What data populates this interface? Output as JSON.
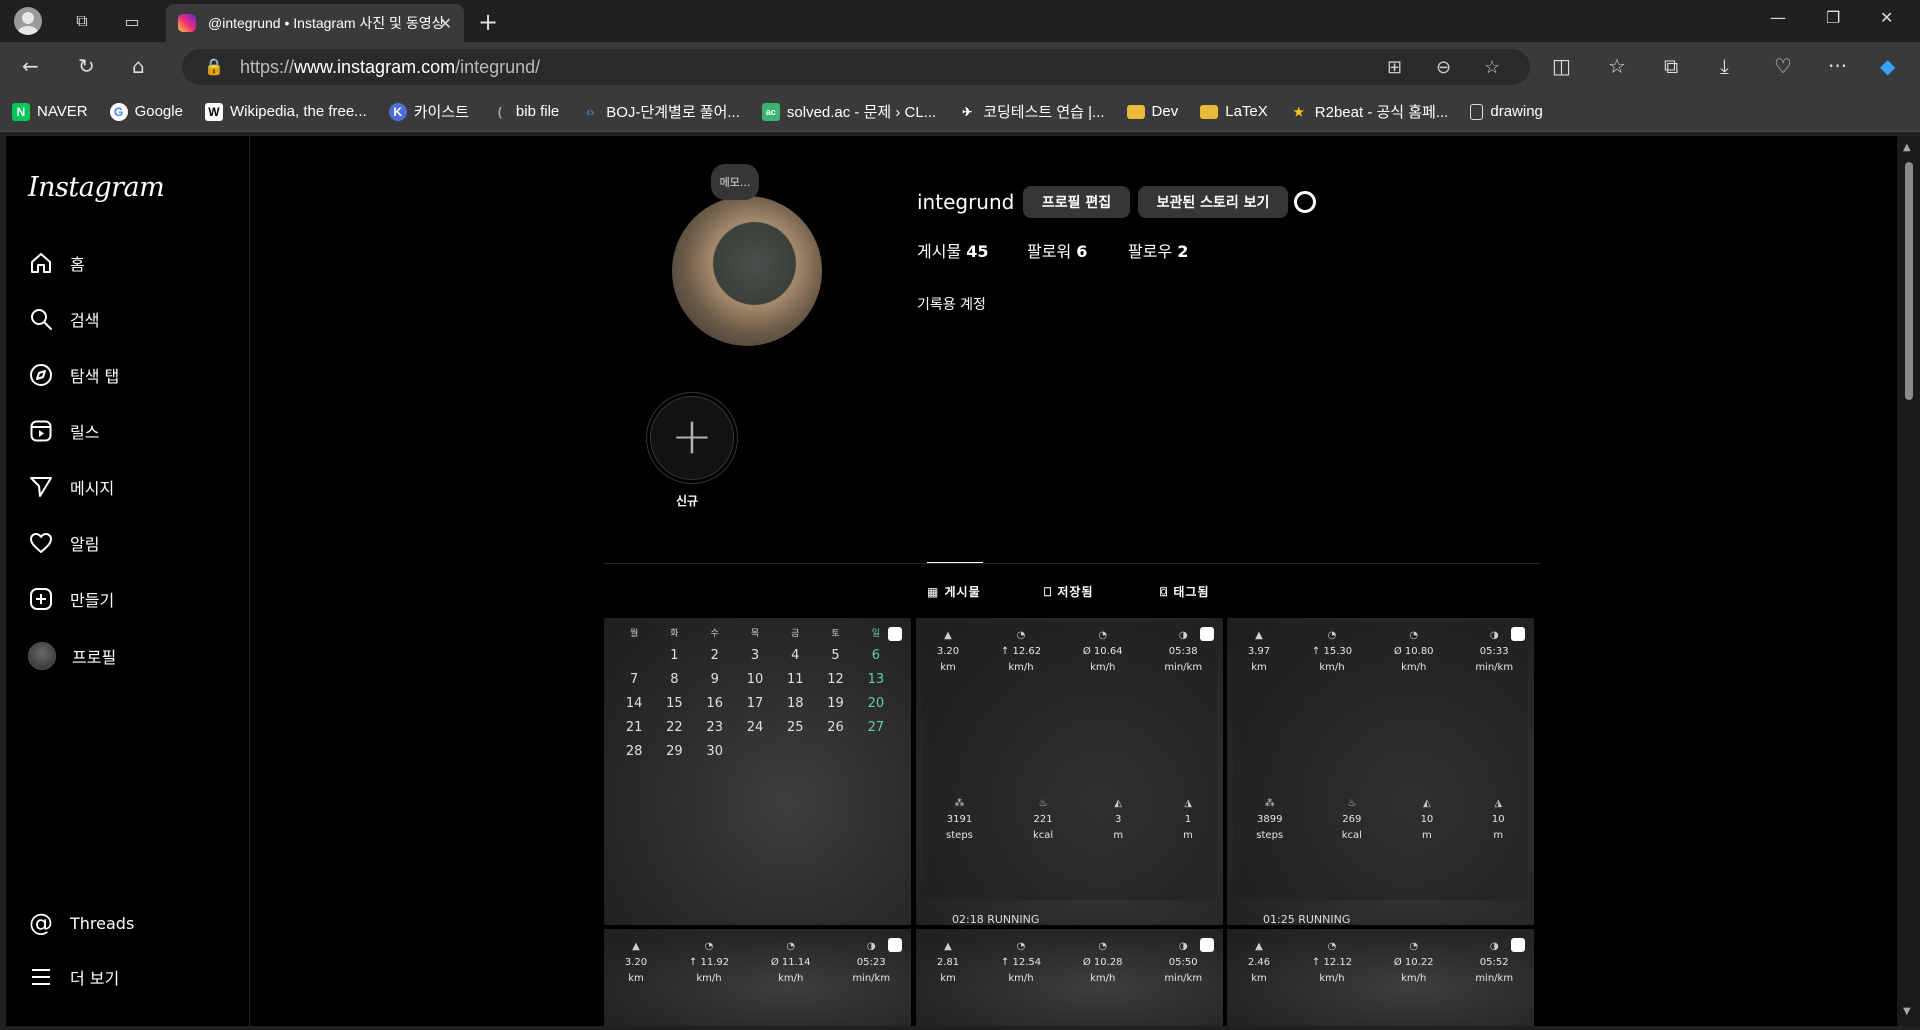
{
  "browser": {
    "tab_title": "@integrund • Instagram 사진 및 동영상",
    "url_prefix": "https://",
    "url_host": "www.instagram.com",
    "url_path": "/integrund/",
    "bookmarks": [
      {
        "label": "NAVER",
        "icon": "N",
        "color": "#03c75a"
      },
      {
        "label": "Google",
        "icon": "G",
        "color": "#4285f4"
      },
      {
        "label": "Wikipedia, the free...",
        "icon": "W",
        "color": "#ffffff"
      },
      {
        "label": "카이스트",
        "icon": "K",
        "color": "#4a6fd8"
      },
      {
        "label": "bib file",
        "icon": "(",
        "color": "#888888"
      },
      {
        "label": "BOJ-단계별로 풀어...",
        "icon": "<>",
        "color": "#3a6ea5"
      },
      {
        "label": "solved.ac - 문제 › CL...",
        "icon": "ac",
        "color": "#3cb371"
      },
      {
        "label": "코딩테스트 연습 |...",
        "icon": "✈",
        "color": "#1e3a8a"
      },
      {
        "label": "Dev",
        "icon": "📁",
        "color": "#e8b93a"
      },
      {
        "label": "LaTeX",
        "icon": "📁",
        "color": "#e8b93a"
      },
      {
        "label": "R2beat - 공식 홈페...",
        "icon": "★",
        "color": "#7b2cbf"
      },
      {
        "label": "drawing",
        "icon": "🗋",
        "color": "#dddddd"
      }
    ]
  },
  "sidebar": {
    "logo": "Instagram",
    "items": [
      {
        "label": "홈",
        "icon": "home-icon"
      },
      {
        "label": "검색",
        "icon": "search-icon"
      },
      {
        "label": "탐색 탭",
        "icon": "compass-icon"
      },
      {
        "label": "릴스",
        "icon": "reels-icon"
      },
      {
        "label": "메시지",
        "icon": "send-icon"
      },
      {
        "label": "알림",
        "icon": "heart-icon"
      },
      {
        "label": "만들기",
        "icon": "plus-square-icon"
      },
      {
        "label": "프로필",
        "icon": "avatar"
      }
    ],
    "threads": "Threads",
    "more": "더 보기"
  },
  "profile": {
    "note": "메모...",
    "username": "integrund",
    "edit_button": "프로필 편집",
    "archive_button": "보관된 스토리 보기",
    "posts_label": "게시물",
    "posts_count": "45",
    "followers_label": "팔로워",
    "followers_count": "6",
    "following_label": "팔로우",
    "following_count": "2",
    "bio": "기록용 계정",
    "highlight_new": "신규"
  },
  "tabs": [
    {
      "label": "게시물",
      "icon": "grid-icon",
      "active": true
    },
    {
      "label": "저장됨",
      "icon": "bookmark-icon",
      "active": false
    },
    {
      "label": "태그됨",
      "icon": "tag-icon",
      "active": false
    }
  ],
  "calendar": {
    "headers": [
      "월",
      "화",
      "수",
      "목",
      "금",
      "토",
      "일"
    ],
    "days": [
      "",
      "1",
      "2",
      "3",
      "4",
      "5",
      "6",
      "7",
      "8",
      "9",
      "10",
      "11",
      "12",
      "13",
      "14",
      "15",
      "16",
      "17",
      "18",
      "19",
      "20",
      "21",
      "22",
      "23",
      "24",
      "25",
      "26",
      "27",
      "28",
      "29",
      "30"
    ]
  },
  "posts": [
    {
      "top": [
        [
          "3.20",
          "km"
        ],
        [
          "↑ 12.62",
          "km/h"
        ],
        [
          "Ø 10.64",
          "km/h"
        ],
        [
          "05:38",
          "min/km"
        ]
      ],
      "bottom": [
        [
          "3191",
          "steps"
        ],
        [
          "221",
          "kcal"
        ],
        [
          "3",
          "m"
        ],
        [
          "1",
          "m"
        ]
      ],
      "footer": "02:18 RUNNING"
    },
    {
      "top": [
        [
          "3.97",
          "km"
        ],
        [
          "↑ 15.30",
          "km/h"
        ],
        [
          "Ø 10.80",
          "km/h"
        ],
        [
          "05:33",
          "min/km"
        ]
      ],
      "bottom": [
        [
          "3899",
          "steps"
        ],
        [
          "269",
          "kcal"
        ],
        [
          "10",
          "m"
        ],
        [
          "10",
          "m"
        ]
      ],
      "footer": "01:25 RUNNING"
    },
    {
      "top": [
        [
          "3.20",
          "km"
        ],
        [
          "↑ 11.92",
          "km/h"
        ],
        [
          "Ø 11.14",
          "km/h"
        ],
        [
          "05:23",
          "min/km"
        ]
      ]
    },
    {
      "top": [
        [
          "2.81",
          "km"
        ],
        [
          "↑ 12.54",
          "km/h"
        ],
        [
          "Ø 10.28",
          "km/h"
        ],
        [
          "05:50",
          "min/km"
        ]
      ]
    },
    {
      "top": [
        [
          "2.46",
          "km"
        ],
        [
          "↑ 12.12",
          "km/h"
        ],
        [
          "Ø 10.22",
          "km/h"
        ],
        [
          "05:52",
          "min/km"
        ]
      ]
    }
  ]
}
